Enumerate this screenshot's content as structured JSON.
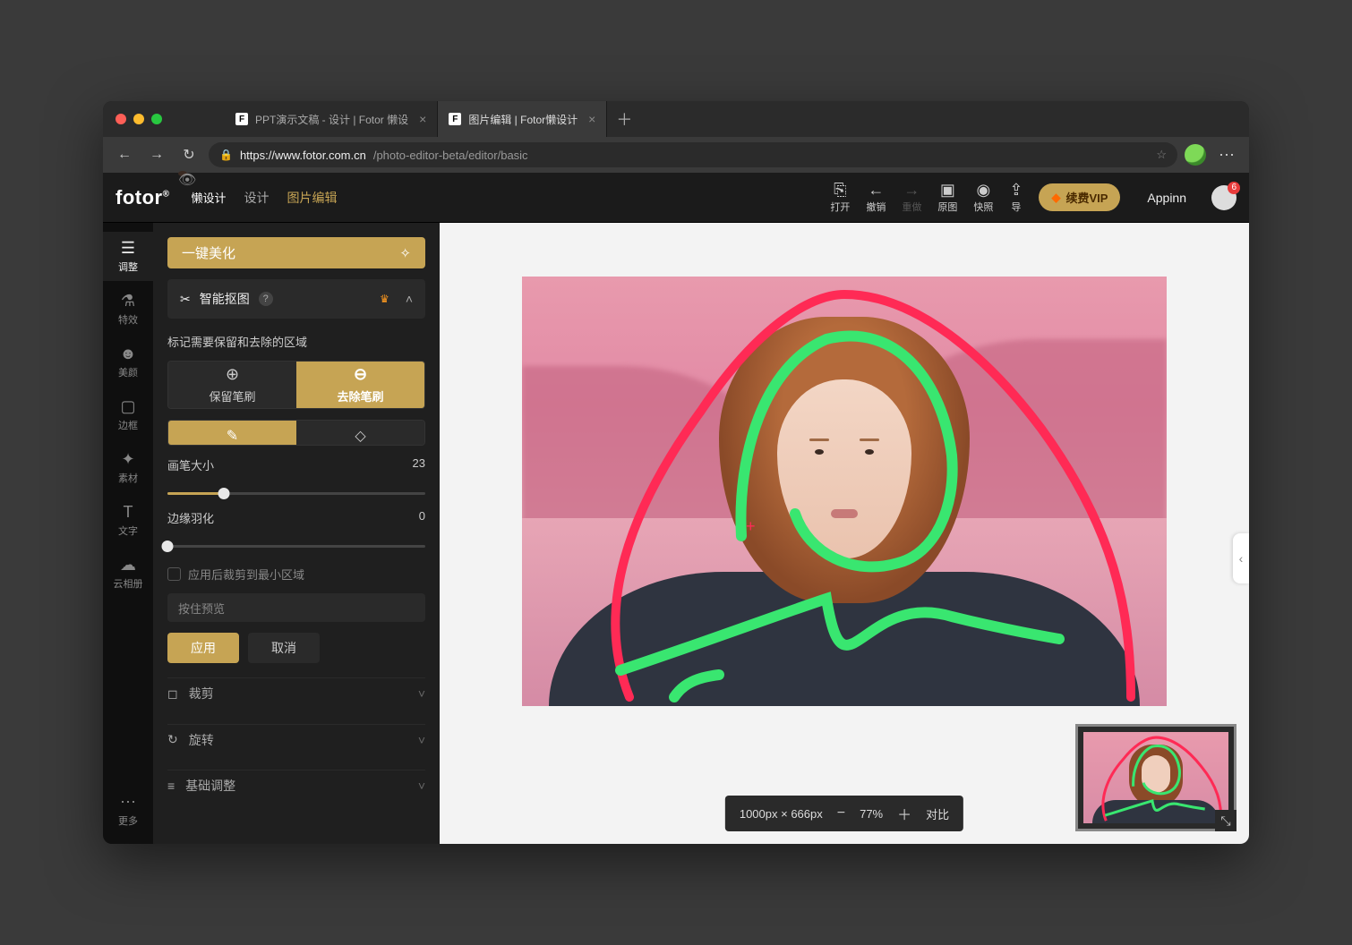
{
  "browser": {
    "tabs": [
      {
        "title": "PPT演示文稿 - 设计 | Fotor 懒设",
        "active": false
      },
      {
        "title": "图片编辑 | Fotor懒设计",
        "active": true
      }
    ],
    "url_host": "https://www.fotor.com.cn",
    "url_path": "/photo-editor-beta/editor/basic"
  },
  "appbar": {
    "brand": "fotor",
    "brand_sub": "懒设计",
    "nav_design": "设计",
    "nav_edit": "图片编辑",
    "items": {
      "open": "打开",
      "undo": "撤销",
      "redo": "重做",
      "original": "原图",
      "snapshot": "快照",
      "export": "导"
    },
    "vip": "续费VIP",
    "user": "Appinn",
    "badge": "6"
  },
  "sidebar": {
    "items": [
      {
        "key": "adjust",
        "label": "调整"
      },
      {
        "key": "effects",
        "label": "特效"
      },
      {
        "key": "beauty",
        "label": "美颜"
      },
      {
        "key": "frame",
        "label": "边框"
      },
      {
        "key": "assets",
        "label": "素材"
      },
      {
        "key": "text",
        "label": "文字"
      },
      {
        "key": "cloud",
        "label": "云相册"
      }
    ],
    "more": "更多"
  },
  "panel": {
    "one_click": "一键美化",
    "smart_cutout": "智能抠图",
    "mark_hint": "标记需要保留和去除的区域",
    "keep_brush": "保留笔刷",
    "remove_brush": "去除笔刷",
    "brush_size_label": "画笔大小",
    "brush_size_value": "23",
    "brush_size_pct": 22,
    "feather_label": "边缘羽化",
    "feather_value": "0",
    "feather_pct": 0,
    "crop_min": "应用后裁剪到最小区域",
    "hold_preview": "按住预览",
    "apply": "应用",
    "cancel": "取消",
    "crop": "裁剪",
    "rotate": "旋转",
    "basic_adjust": "基础调整"
  },
  "canvas": {
    "dimensions": "1000px × 666px",
    "zoom": "77%",
    "compare": "对比"
  }
}
